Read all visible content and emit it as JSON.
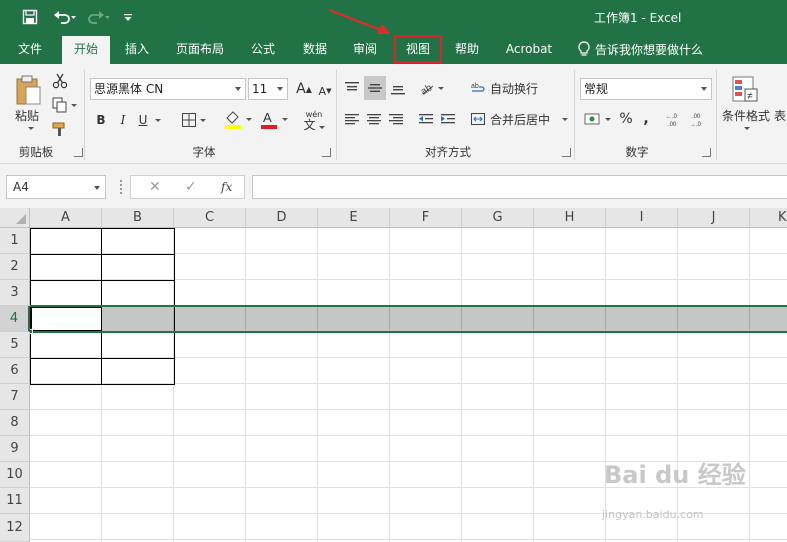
{
  "window": {
    "title": "工作簿1  -  Excel"
  },
  "tabs": [
    {
      "label": "文件",
      "active": false,
      "highlight": false
    },
    {
      "label": "开始",
      "active": true,
      "highlight": false
    },
    {
      "label": "插入",
      "active": false,
      "highlight": false
    },
    {
      "label": "页面布局",
      "active": false,
      "highlight": false
    },
    {
      "label": "公式",
      "active": false,
      "highlight": false
    },
    {
      "label": "数据",
      "active": false,
      "highlight": false
    },
    {
      "label": "审阅",
      "active": false,
      "highlight": false
    },
    {
      "label": "视图",
      "active": false,
      "highlight": true
    },
    {
      "label": "帮助",
      "active": false,
      "highlight": false
    },
    {
      "label": "Acrobat",
      "active": false,
      "highlight": false
    }
  ],
  "tell_me": "告诉我你想要做什么",
  "ribbon": {
    "clipboard": {
      "paste_label": "粘贴",
      "group_label": "剪贴板"
    },
    "font": {
      "font_name": "思源黑体 CN",
      "font_size": "11",
      "bold": "B",
      "italic": "I",
      "underline": "U",
      "increase": "A",
      "decrease": "A",
      "group_label": "字体",
      "phonetic": "wén"
    },
    "alignment": {
      "wrap_text": "自动换行",
      "merge_center": "合并后居中",
      "group_label": "对齐方式"
    },
    "number": {
      "format": "常规",
      "percent": "%",
      "comma": ",",
      "group_label": "数字"
    },
    "styles": {
      "conditional_format": "条件格式",
      "table_partial": "表"
    }
  },
  "formula_bar": {
    "name_box": "A4",
    "fx": "fx",
    "formula": ""
  },
  "grid": {
    "columns": [
      "A",
      "B",
      "C",
      "D",
      "E",
      "F",
      "G",
      "H",
      "I",
      "J",
      "K"
    ],
    "rows": [
      "1",
      "2",
      "3",
      "4",
      "5",
      "6",
      "7",
      "8",
      "9",
      "10",
      "11",
      "12"
    ],
    "selected_row": "4",
    "active_cell": "A4"
  },
  "watermark": {
    "text": "Bai du 经验",
    "sub": "jingyan.baidu.com"
  },
  "colors": {
    "excel_green": "#217346",
    "highlight_red": "#e0212b",
    "arrow_red": "#e02a2a"
  }
}
